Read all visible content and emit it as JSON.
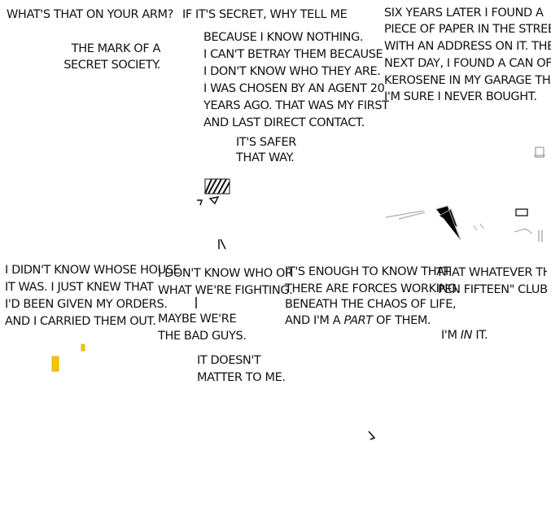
{
  "panels": [
    {
      "lines": [
        "WHAT'S THAT ON YOUR ARM?"
      ],
      "reply": [
        "THE MARK OF A",
        "SECRET SOCIETY."
      ]
    },
    {
      "title": "IF IT'S SECRET, WHY TELL ME",
      "lines": [
        "BECAUSE I KNOW NOTHING.",
        "I CAN'T BETRAY THEM BECAUSE",
        "I DON'T KNOW WHO THEY ARE.",
        "I WAS CHOSEN BY AN AGENT 20",
        "YEARS AGO. THAT WAS MY FIRST",
        "AND LAST DIRECT CONTACT."
      ],
      "reply": [
        "IT'S SAFER",
        "THAT WAY."
      ]
    },
    {
      "lines": [
        "SIX YEARS LATER I FOUND A",
        "PIECE OF PAPER IN THE STREET",
        "WITH AN ADDRESS ON IT. THE",
        "NEXT DAY, I FOUND A CAN OF",
        "KEROSENE IN MY GARAGE THAT",
        "I'M SURE I NEVER BOUGHT."
      ]
    },
    {
      "lines": [
        "I DIDN'T KNOW WHOSE HOUSE",
        "IT WAS. I JUST KNEW THAT",
        "I'D BEEN GIVEN MY ORDERS.",
        "AND I CARRIED THEM OUT."
      ]
    },
    {
      "lines": [
        "I DON'T KNOW WHO OR",
        "WHAT WE'RE FIGHTING."
      ],
      "maybe": [
        "MAYBE WE'RE",
        "THE BAD GUYS."
      ],
      "reply": [
        "IT DOESN'T",
        "MATTER TO ME."
      ]
    },
    {
      "lines": [
        "IT'S ENOUGH TO KNOW THAT",
        "THERE ARE FORCES WORKING",
        "BENEATH THE CHAOS OF LIFE,"
      ],
      "last_pre": "AND I'M A ",
      "last_em": "PART",
      "last_post": " OF THEM."
    },
    {
      "lines": [
        "THAT WHATEVER THIS",
        "PEN FIFTEEN\" CLUB IS,"
      ],
      "final_pre": "I'M ",
      "final_em": "IN",
      "final_post": " IT."
    }
  ],
  "colors": {
    "ink": "#111111",
    "fire": "#f5c400",
    "background": "#ffffff"
  }
}
